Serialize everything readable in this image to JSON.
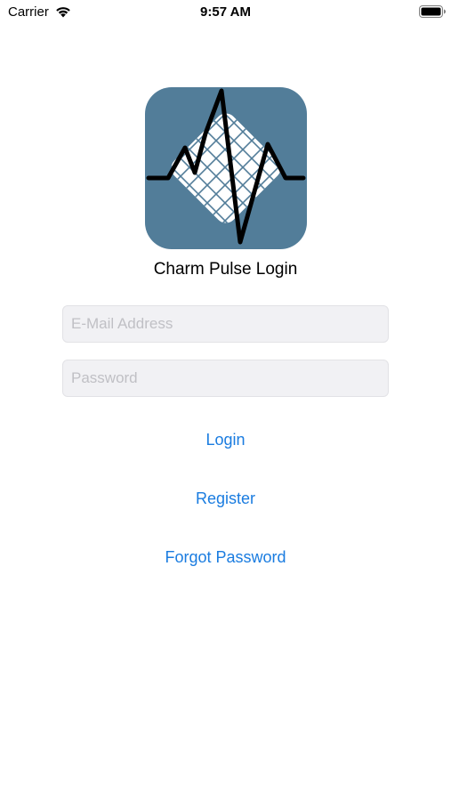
{
  "status_bar": {
    "carrier": "Carrier",
    "time": "9:57 AM"
  },
  "app": {
    "title": "Charm Pulse Login",
    "logo_icon": "pulse-grid-logo",
    "logo_color": "#527d99"
  },
  "form": {
    "email_placeholder": "E-Mail Address",
    "email_value": "",
    "password_placeholder": "Password",
    "password_value": ""
  },
  "actions": {
    "login_label": "Login",
    "register_label": "Register",
    "forgot_label": "Forgot Password",
    "link_color": "#1a7ce0"
  }
}
